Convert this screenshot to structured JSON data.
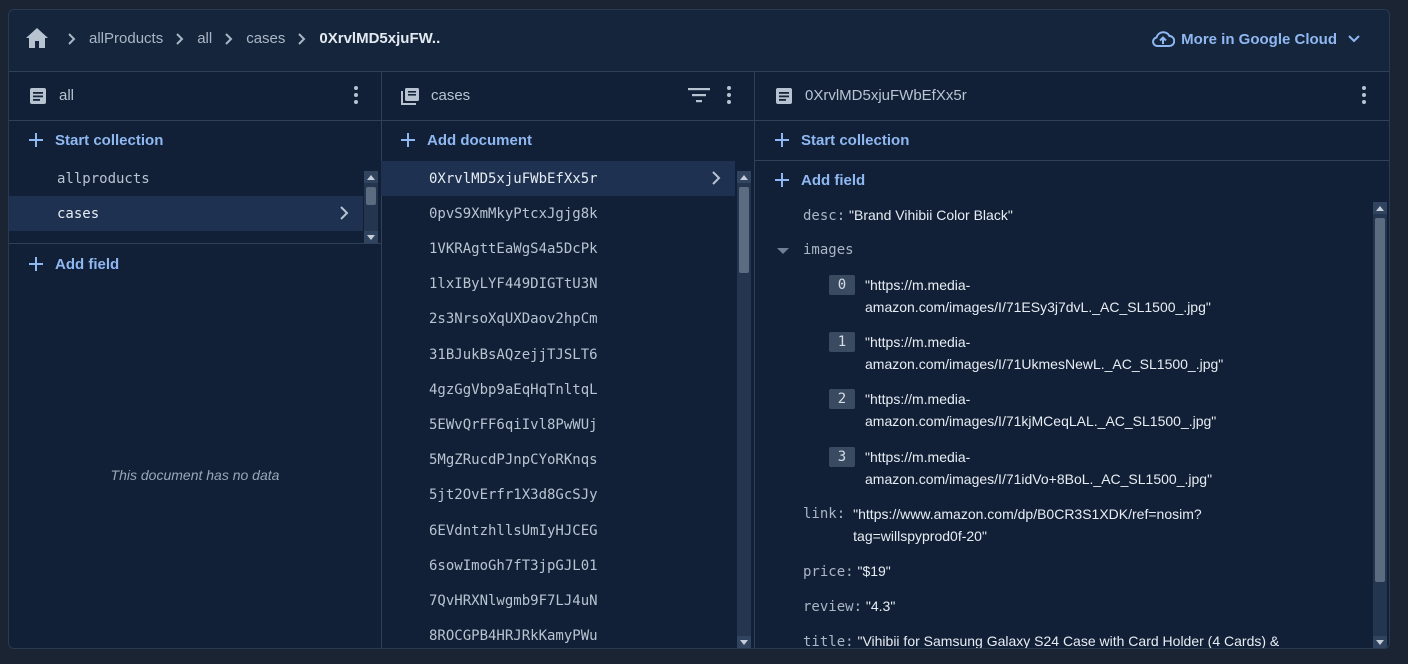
{
  "breadcrumb": {
    "items": [
      "allProducts",
      "all",
      "cases",
      "0XrvlMD5xjuFW.."
    ]
  },
  "cloud_link": {
    "label": "More in Google Cloud"
  },
  "col1": {
    "title": "all",
    "start_collection": "Start collection",
    "collections": [
      "allproducts",
      "cases"
    ],
    "selected_index": 1,
    "add_field": "Add field",
    "empty_text": "This document has no data"
  },
  "col2": {
    "title": "cases",
    "add_document": "Add document",
    "documents": [
      "0XrvlMD5xjuFWbEfXx5r",
      "0pvS9XmMkyPtcxJgjg8k",
      "1VKRAgttEaWgS4a5DcPk",
      "1lxIByLYF449DIGTtU3N",
      "2s3NrsoXqUXDaov2hpCm",
      "31BJukBsAQzejjTJSLT6",
      "4gzGgVbp9aEqHqTnltqL",
      "5EWvQrFF6qiIvl8PwWUj",
      "5MgZRucdPJnpCYoRKnqs",
      "5jt2OvErfr1X3d8GcSJy",
      "6EVdntzhllsUmIyHJCEG",
      "6sowImoGh7fT3jpGJL01",
      "7QvHRXNlwgmb9F7LJ4uN",
      "8ROCGPB4HRJRkKamyPWu"
    ],
    "selected_index": 0
  },
  "col3": {
    "title": "0XrvlMD5xjuFWbEfXx5r",
    "start_collection": "Start collection",
    "add_field": "Add field",
    "desc": {
      "key": "desc:",
      "value": "\"Brand Vihibii Color Black\""
    },
    "images": {
      "key": "images",
      "items": [
        {
          "index": "0",
          "line1": "\"https://m.media-",
          "line2": "amazon.com/images/I/71ESy3j7dvL._AC_SL1500_.jpg\""
        },
        {
          "index": "1",
          "line1": "\"https://m.media-",
          "line2": "amazon.com/images/I/71UkmesNewL._AC_SL1500_.jpg\""
        },
        {
          "index": "2",
          "line1": "\"https://m.media-",
          "line2": "amazon.com/images/I/71kjMCeqLAL._AC_SL1500_.jpg\""
        },
        {
          "index": "3",
          "line1": "\"https://m.media-",
          "line2": "amazon.com/images/I/71idVo+8BoL._AC_SL1500_.jpg\""
        }
      ]
    },
    "link": {
      "key": "link:",
      "line1": "\"https://www.amazon.com/dp/B0CR3S1XDK/ref=nosim?",
      "line2": "tag=willspyprod0f-20\""
    },
    "price": {
      "key": "price:",
      "value": "\"$19\""
    },
    "review": {
      "key": "review:",
      "value": "\"4.3\""
    },
    "title_field": {
      "key": "title:",
      "value": "\"Vihibii for Samsung Galaxy S24 Case with Card Holder (4 Cards) &"
    }
  }
}
